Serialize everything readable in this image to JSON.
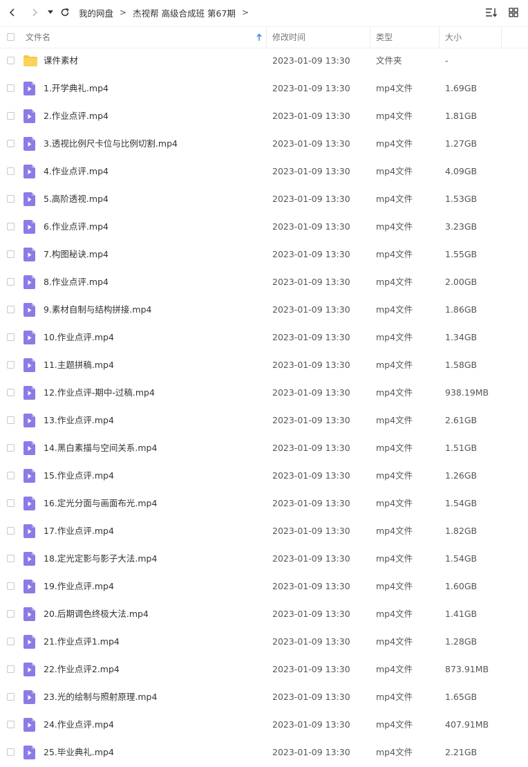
{
  "toolbar": {
    "breadcrumb": [
      "我的网盘",
      "杰视帮 高级合成班 第67期"
    ],
    "separator": ">"
  },
  "columns": {
    "name": "文件名",
    "modified": "修改时间",
    "type": "类型",
    "size": "大小"
  },
  "colors": {
    "folder": "#f8c83a",
    "video_file": "#8a7be6",
    "sort_arrow": "#3c8ae8"
  },
  "rows": [
    {
      "icon": "folder-icon",
      "name": "课件素材",
      "time": "2023-01-09 13:30",
      "type": "文件夹",
      "size": "-"
    },
    {
      "icon": "video-file-icon",
      "name": "1.开学典礼.mp4",
      "time": "2023-01-09 13:30",
      "type": "mp4文件",
      "size": "1.69GB"
    },
    {
      "icon": "video-file-icon",
      "name": "2.作业点评.mp4",
      "time": "2023-01-09 13:30",
      "type": "mp4文件",
      "size": "1.81GB"
    },
    {
      "icon": "video-file-icon",
      "name": "3.透视比例尺卡位与比例切割.mp4",
      "time": "2023-01-09 13:30",
      "type": "mp4文件",
      "size": "1.27GB"
    },
    {
      "icon": "video-file-icon",
      "name": "4.作业点评.mp4",
      "time": "2023-01-09 13:30",
      "type": "mp4文件",
      "size": "4.09GB"
    },
    {
      "icon": "video-file-icon",
      "name": "5.高阶透视.mp4",
      "time": "2023-01-09 13:30",
      "type": "mp4文件",
      "size": "1.53GB"
    },
    {
      "icon": "video-file-icon",
      "name": "6.作业点评.mp4",
      "time": "2023-01-09 13:30",
      "type": "mp4文件",
      "size": "3.23GB"
    },
    {
      "icon": "video-file-icon",
      "name": "7.构图秘诀.mp4",
      "time": "2023-01-09 13:30",
      "type": "mp4文件",
      "size": "1.55GB"
    },
    {
      "icon": "video-file-icon",
      "name": "8.作业点评.mp4",
      "time": "2023-01-09 13:30",
      "type": "mp4文件",
      "size": "2.00GB"
    },
    {
      "icon": "video-file-icon",
      "name": "9.素材自制与结构拼接.mp4",
      "time": "2023-01-09 13:30",
      "type": "mp4文件",
      "size": "1.86GB"
    },
    {
      "icon": "video-file-icon",
      "name": "10.作业点评.mp4",
      "time": "2023-01-09 13:30",
      "type": "mp4文件",
      "size": "1.34GB"
    },
    {
      "icon": "video-file-icon",
      "name": "11.主题拼稿.mp4",
      "time": "2023-01-09 13:30",
      "type": "mp4文件",
      "size": "1.58GB"
    },
    {
      "icon": "video-file-icon",
      "name": "12.作业点评-期中-过稿.mp4",
      "time": "2023-01-09 13:30",
      "type": "mp4文件",
      "size": "938.19MB"
    },
    {
      "icon": "video-file-icon",
      "name": "13.作业点评.mp4",
      "time": "2023-01-09 13:30",
      "type": "mp4文件",
      "size": "2.61GB"
    },
    {
      "icon": "video-file-icon",
      "name": "14.黑白素描与空间关系.mp4",
      "time": "2023-01-09 13:30",
      "type": "mp4文件",
      "size": "1.51GB"
    },
    {
      "icon": "video-file-icon",
      "name": "15.作业点评.mp4",
      "time": "2023-01-09 13:30",
      "type": "mp4文件",
      "size": "1.26GB"
    },
    {
      "icon": "video-file-icon",
      "name": "16.定光分面与画面布光.mp4",
      "time": "2023-01-09 13:30",
      "type": "mp4文件",
      "size": "1.54GB"
    },
    {
      "icon": "video-file-icon",
      "name": "17.作业点评.mp4",
      "time": "2023-01-09 13:30",
      "type": "mp4文件",
      "size": "1.82GB"
    },
    {
      "icon": "video-file-icon",
      "name": "18.定光定影与影子大法.mp4",
      "time": "2023-01-09 13:30",
      "type": "mp4文件",
      "size": "1.54GB"
    },
    {
      "icon": "video-file-icon",
      "name": "19.作业点评.mp4",
      "time": "2023-01-09 13:30",
      "type": "mp4文件",
      "size": "1.60GB"
    },
    {
      "icon": "video-file-icon",
      "name": "20.后期调色终极大法.mp4",
      "time": "2023-01-09 13:30",
      "type": "mp4文件",
      "size": "1.41GB"
    },
    {
      "icon": "video-file-icon",
      "name": "21.作业点评1.mp4",
      "time": "2023-01-09 13:30",
      "type": "mp4文件",
      "size": "1.28GB"
    },
    {
      "icon": "video-file-icon",
      "name": "22.作业点评2.mp4",
      "time": "2023-01-09 13:30",
      "type": "mp4文件",
      "size": "873.91MB"
    },
    {
      "icon": "video-file-icon",
      "name": "23.光的绘制与照射原理.mp4",
      "time": "2023-01-09 13:30",
      "type": "mp4文件",
      "size": "1.65GB"
    },
    {
      "icon": "video-file-icon",
      "name": "24.作业点评.mp4",
      "time": "2023-01-09 13:30",
      "type": "mp4文件",
      "size": "407.91MB"
    },
    {
      "icon": "video-file-icon",
      "name": "25.毕业典礼.mp4",
      "time": "2023-01-09 13:30",
      "type": "mp4文件",
      "size": "2.21GB"
    }
  ]
}
